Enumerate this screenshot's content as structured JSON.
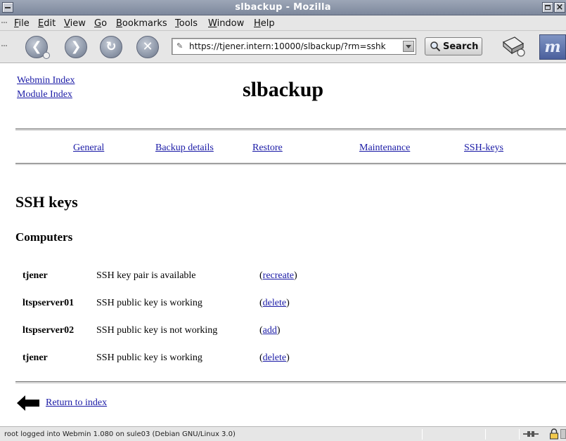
{
  "window": {
    "title": "slbackup - Mozilla"
  },
  "menu": [
    {
      "pre": "",
      "key": "F",
      "post": "ile"
    },
    {
      "pre": "",
      "key": "E",
      "post": "dit"
    },
    {
      "pre": "",
      "key": "V",
      "post": "iew"
    },
    {
      "pre": "",
      "key": "G",
      "post": "o"
    },
    {
      "pre": "",
      "key": "B",
      "post": "ookmarks"
    },
    {
      "pre": "",
      "key": "T",
      "post": "ools"
    },
    {
      "pre": "",
      "key": "W",
      "post": "indow"
    },
    {
      "pre": "",
      "key": "H",
      "post": "elp"
    }
  ],
  "toolbar": {
    "url": "https://tjener.intern:10000/slbackup/?rm=sshk",
    "search_label": "Search",
    "icons": [
      "back-icon",
      "forward-icon",
      "reload-icon",
      "stop-icon",
      "print-icon",
      "mozilla-throbber-icon"
    ]
  },
  "page": {
    "webmin_index": "Webmin Index",
    "module_index": "Module Index",
    "title": "slbackup",
    "tabs": [
      "General",
      "Backup details",
      "Restore",
      "Maintenance",
      "SSH-keys"
    ],
    "section_title": "SSH keys",
    "subsection_title": "Computers",
    "computers": [
      {
        "host": "tjener",
        "status": "SSH key pair is available",
        "action": "recreate"
      },
      {
        "host": "ltspserver01",
        "status": "SSH public key is working",
        "action": "delete"
      },
      {
        "host": "ltspserver02",
        "status": "SSH public key is not working",
        "action": "add"
      },
      {
        "host": "tjener",
        "status": "SSH public key is working",
        "action": "delete"
      }
    ],
    "return_link": "Return to index"
  },
  "statusbar": {
    "text": "root logged into Webmin 1.080 on sule03 (Debian GNU/Linux 3.0)"
  },
  "colors": {
    "link": "#1a1aa6",
    "titlebar": "#8a94a8",
    "chrome": "#e6e6e6"
  }
}
